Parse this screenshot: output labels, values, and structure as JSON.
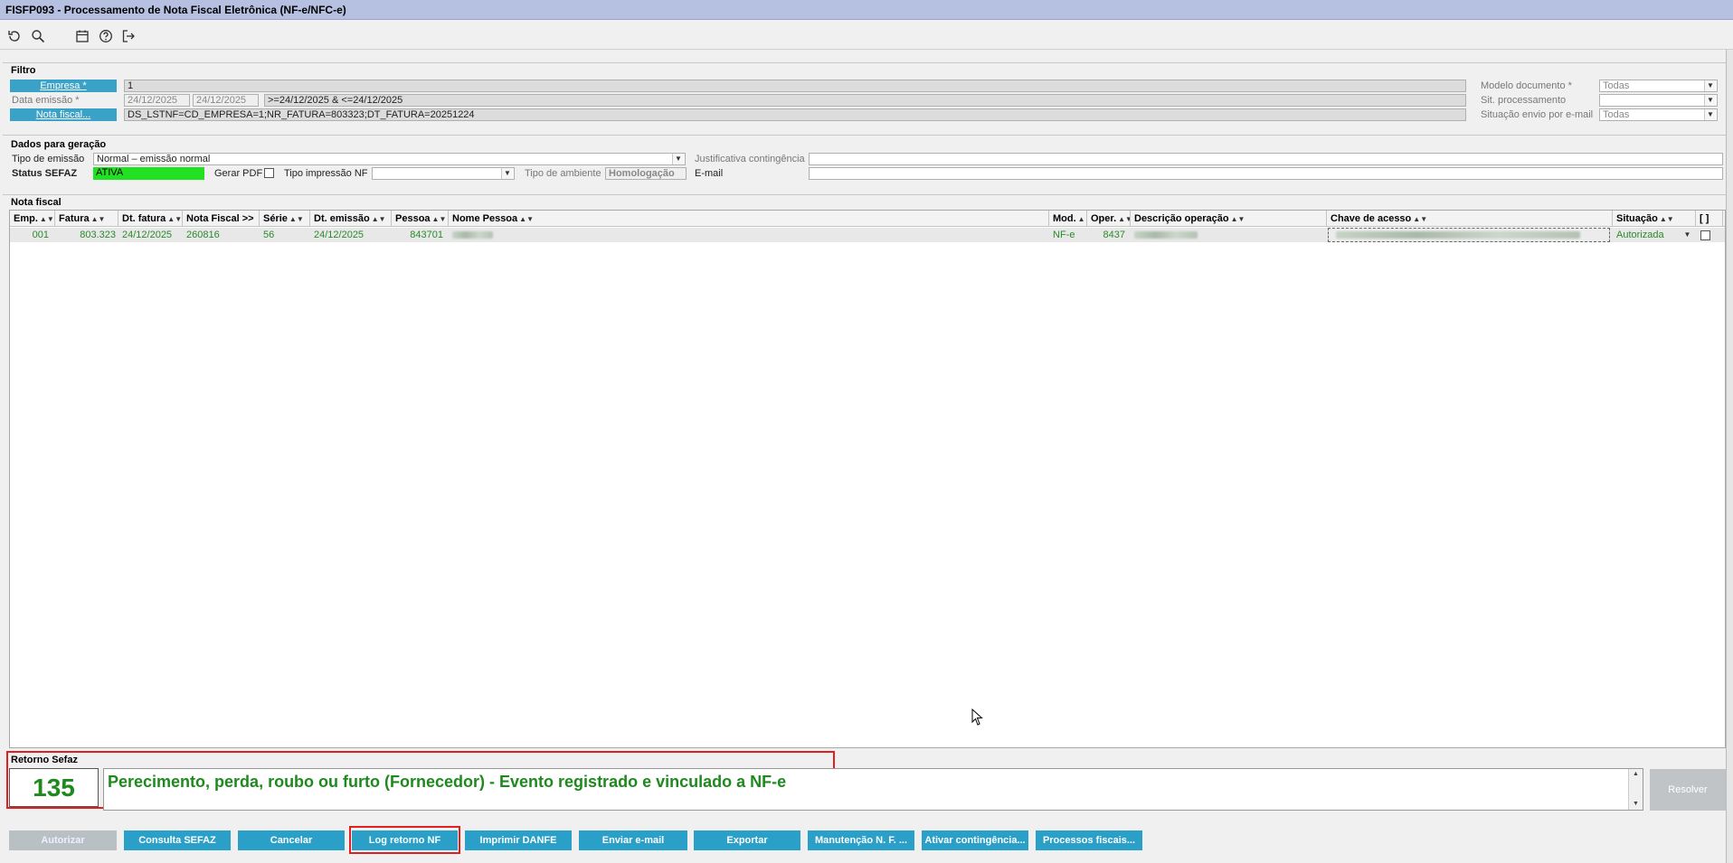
{
  "window": {
    "title": "FISFP093 - Processamento de Nota Fiscal Eletrônica (NF-e/NFC-e)"
  },
  "toolbar": {
    "icons": [
      "undo-icon",
      "search-icon",
      "calendar-icon",
      "help-icon",
      "exit-icon"
    ]
  },
  "filtro": {
    "title": "Filtro",
    "empresa_label": "Empresa *",
    "empresa_value": "1",
    "data_emissao_label": "Data emissão *",
    "data_de": "24/12/2025",
    "data_ate": "24/12/2025",
    "data_expr": ">=24/12/2025 & <=24/12/2025",
    "nota_fiscal_label": "Nota fiscal...",
    "nota_fiscal_expr": "DS_LSTNF=CD_EMPRESA=1;NR_FATURA=803323;DT_FATURA=20251224",
    "modelo_label": "Modelo documento *",
    "modelo_value": "Todas",
    "sit_proc_label": "Sit. processamento",
    "sit_proc_value": "",
    "sit_envio_label": "Situação envio por e-mail",
    "sit_envio_value": "Todas"
  },
  "geracao": {
    "title": "Dados para geração",
    "tipo_emissao_label": "Tipo de emissão",
    "tipo_emissao_value": "Normal – emissão normal",
    "justificativa_label": "Justificativa contingência",
    "status_label": "Status SEFAZ",
    "status_value": "ATIVA",
    "gerar_pdf_label": "Gerar PDF",
    "tipo_impressao_label": "Tipo impressão NF",
    "tipo_ambiente_label": "Tipo de ambiente",
    "tipo_ambiente_value": "Homologação",
    "email_label": "E-mail"
  },
  "nota_fiscal": {
    "title": "Nota fiscal",
    "columns": {
      "emp": "Emp.",
      "fatura": "Fatura",
      "dt_fatura": "Dt. fatura",
      "nota_fiscal": "Nota Fiscal >>",
      "serie": "Série",
      "dt_emissao": "Dt. emissão",
      "pessoa": "Pessoa",
      "nome_pessoa": "Nome Pessoa",
      "mod": "Mod.",
      "oper": "Oper.",
      "descricao": "Descrição operação",
      "chave": "Chave de acesso",
      "situacao": "Situação",
      "sel": "[ ]"
    },
    "rows": [
      {
        "emp": "001",
        "fatura": "803.323",
        "dt_fatura": "24/12/2025",
        "nota_fiscal": "260816",
        "serie": "56",
        "dt_emissao": "24/12/2025",
        "pessoa": "843701",
        "mod": "NF-e",
        "oper": "8437",
        "situacao": "Autorizada"
      }
    ]
  },
  "retorno": {
    "title": "Retorno Sefaz",
    "code": "135",
    "message": "Perecimento, perda, roubo ou furto (Fornecedor) - Evento registrado e vinculado a NF-e",
    "resolver_label": "Resolver"
  },
  "actions": {
    "autorizar": "Autorizar",
    "consulta_sefaz": "Consulta SEFAZ",
    "cancelar": "Cancelar",
    "log_retorno": "Log retorno NF",
    "imprimir_danfe": "Imprimir DANFE",
    "enviar_email": "Enviar e-mail",
    "exportar": "Exportar",
    "manutencao": "Manutenção N. F. ...",
    "ativar_contingencia": "Ativar contingência...",
    "processos_fiscais": "Processos fiscais..."
  },
  "colors": {
    "accent": "#2aa0c8",
    "status_green": "#22e022",
    "text_green": "#1e8a1e",
    "highlight_red": "#e02020",
    "title_bar": "#b6c0e1"
  }
}
